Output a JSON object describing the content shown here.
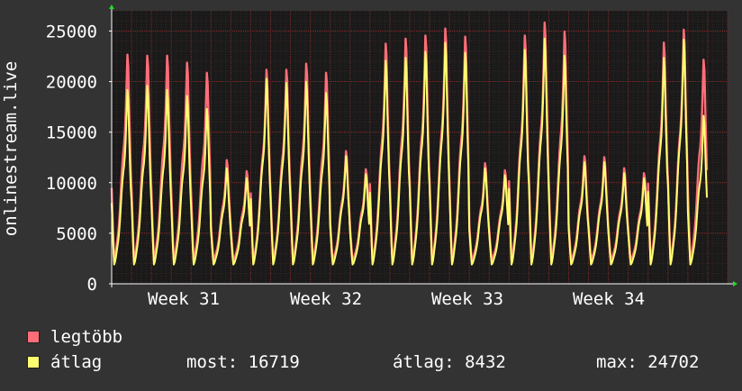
{
  "chart_data": {
    "type": "area",
    "ylabel": "onlinestream.live",
    "ylim": [
      0,
      27000
    ],
    "yticks": [
      0,
      5000,
      10000,
      15000,
      20000,
      25000
    ],
    "xticks": [
      "Week 31",
      "Week 32",
      "Week 33",
      "Week 34"
    ],
    "grid": true,
    "colors": {
      "background": "#333333",
      "plot": "#1a1a1a",
      "max": "#ff6e78",
      "avg": "#ffff70",
      "grid_major": "#8a2a2a",
      "grid_minor": "#3a2424",
      "axis": "#ffffff",
      "arrow": "#22dd22"
    },
    "series": [
      {
        "name": "legtöbb",
        "color": "#ff6e78",
        "daily_peaks": [
          22800,
          22700,
          22700,
          22000,
          21000,
          12300,
          11200,
          21300,
          21300,
          21900,
          21000,
          13200,
          11400,
          23900,
          24400,
          24700,
          25400,
          24600,
          12000,
          11300,
          24700,
          26000,
          25100,
          12700,
          12600,
          11500,
          11000,
          24000,
          25300,
          22300
        ]
      },
      {
        "name": "átlag",
        "color": "#ffff70",
        "daily_peaks": [
          19300,
          19700,
          19300,
          18700,
          17400,
          11500,
          10500,
          20400,
          20000,
          20100,
          19000,
          12700,
          10900,
          22200,
          22500,
          23100,
          24000,
          23000,
          11500,
          10800,
          23300,
          24400,
          22700,
          12100,
          12100,
          11000,
          10500,
          22500,
          24300,
          16719
        ]
      }
    ]
  },
  "legend": [
    {
      "label": "legtöbb",
      "color": "#ff6e78"
    },
    {
      "label": "átlag",
      "color": "#ffff70"
    }
  ],
  "stats": {
    "most": "most: 16719",
    "atlag": "átlag: 8432",
    "max": "max: 24702"
  }
}
